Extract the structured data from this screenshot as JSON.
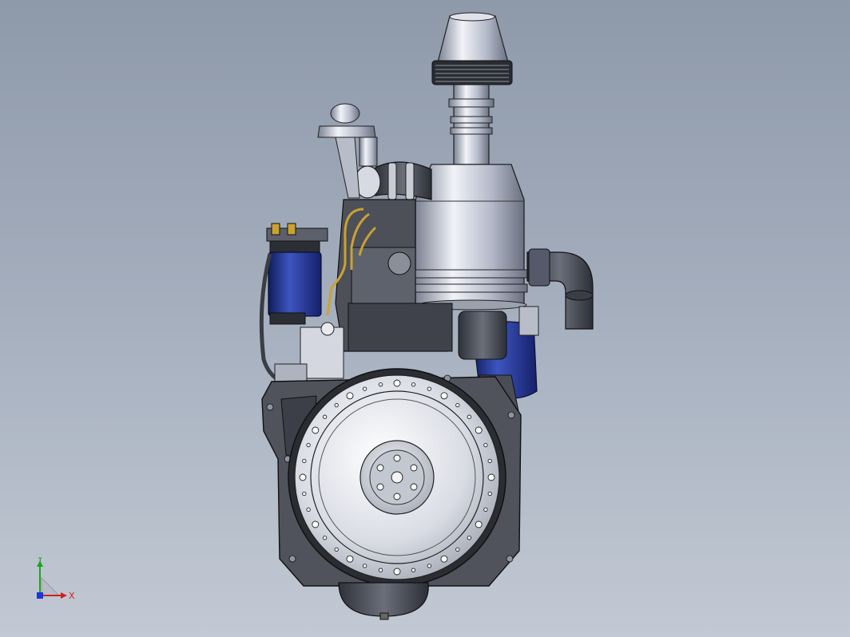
{
  "viewport": {
    "background_top": "#8e99aa",
    "background_bottom": "#c2c9d4"
  },
  "model": {
    "colors": {
      "metal_light": "#e4e7ee",
      "metal_mid": "#9aa1b0",
      "metal_dark": "#3c4049",
      "filter_blue": "#23368f",
      "brass": "#c9a232",
      "outline": "#1b1c20"
    }
  },
  "triad": {
    "x_label": "X",
    "y_label": "Y",
    "x_color": "#d21f1f",
    "y_color": "#1ea51e",
    "z_color": "#1d36d4"
  }
}
